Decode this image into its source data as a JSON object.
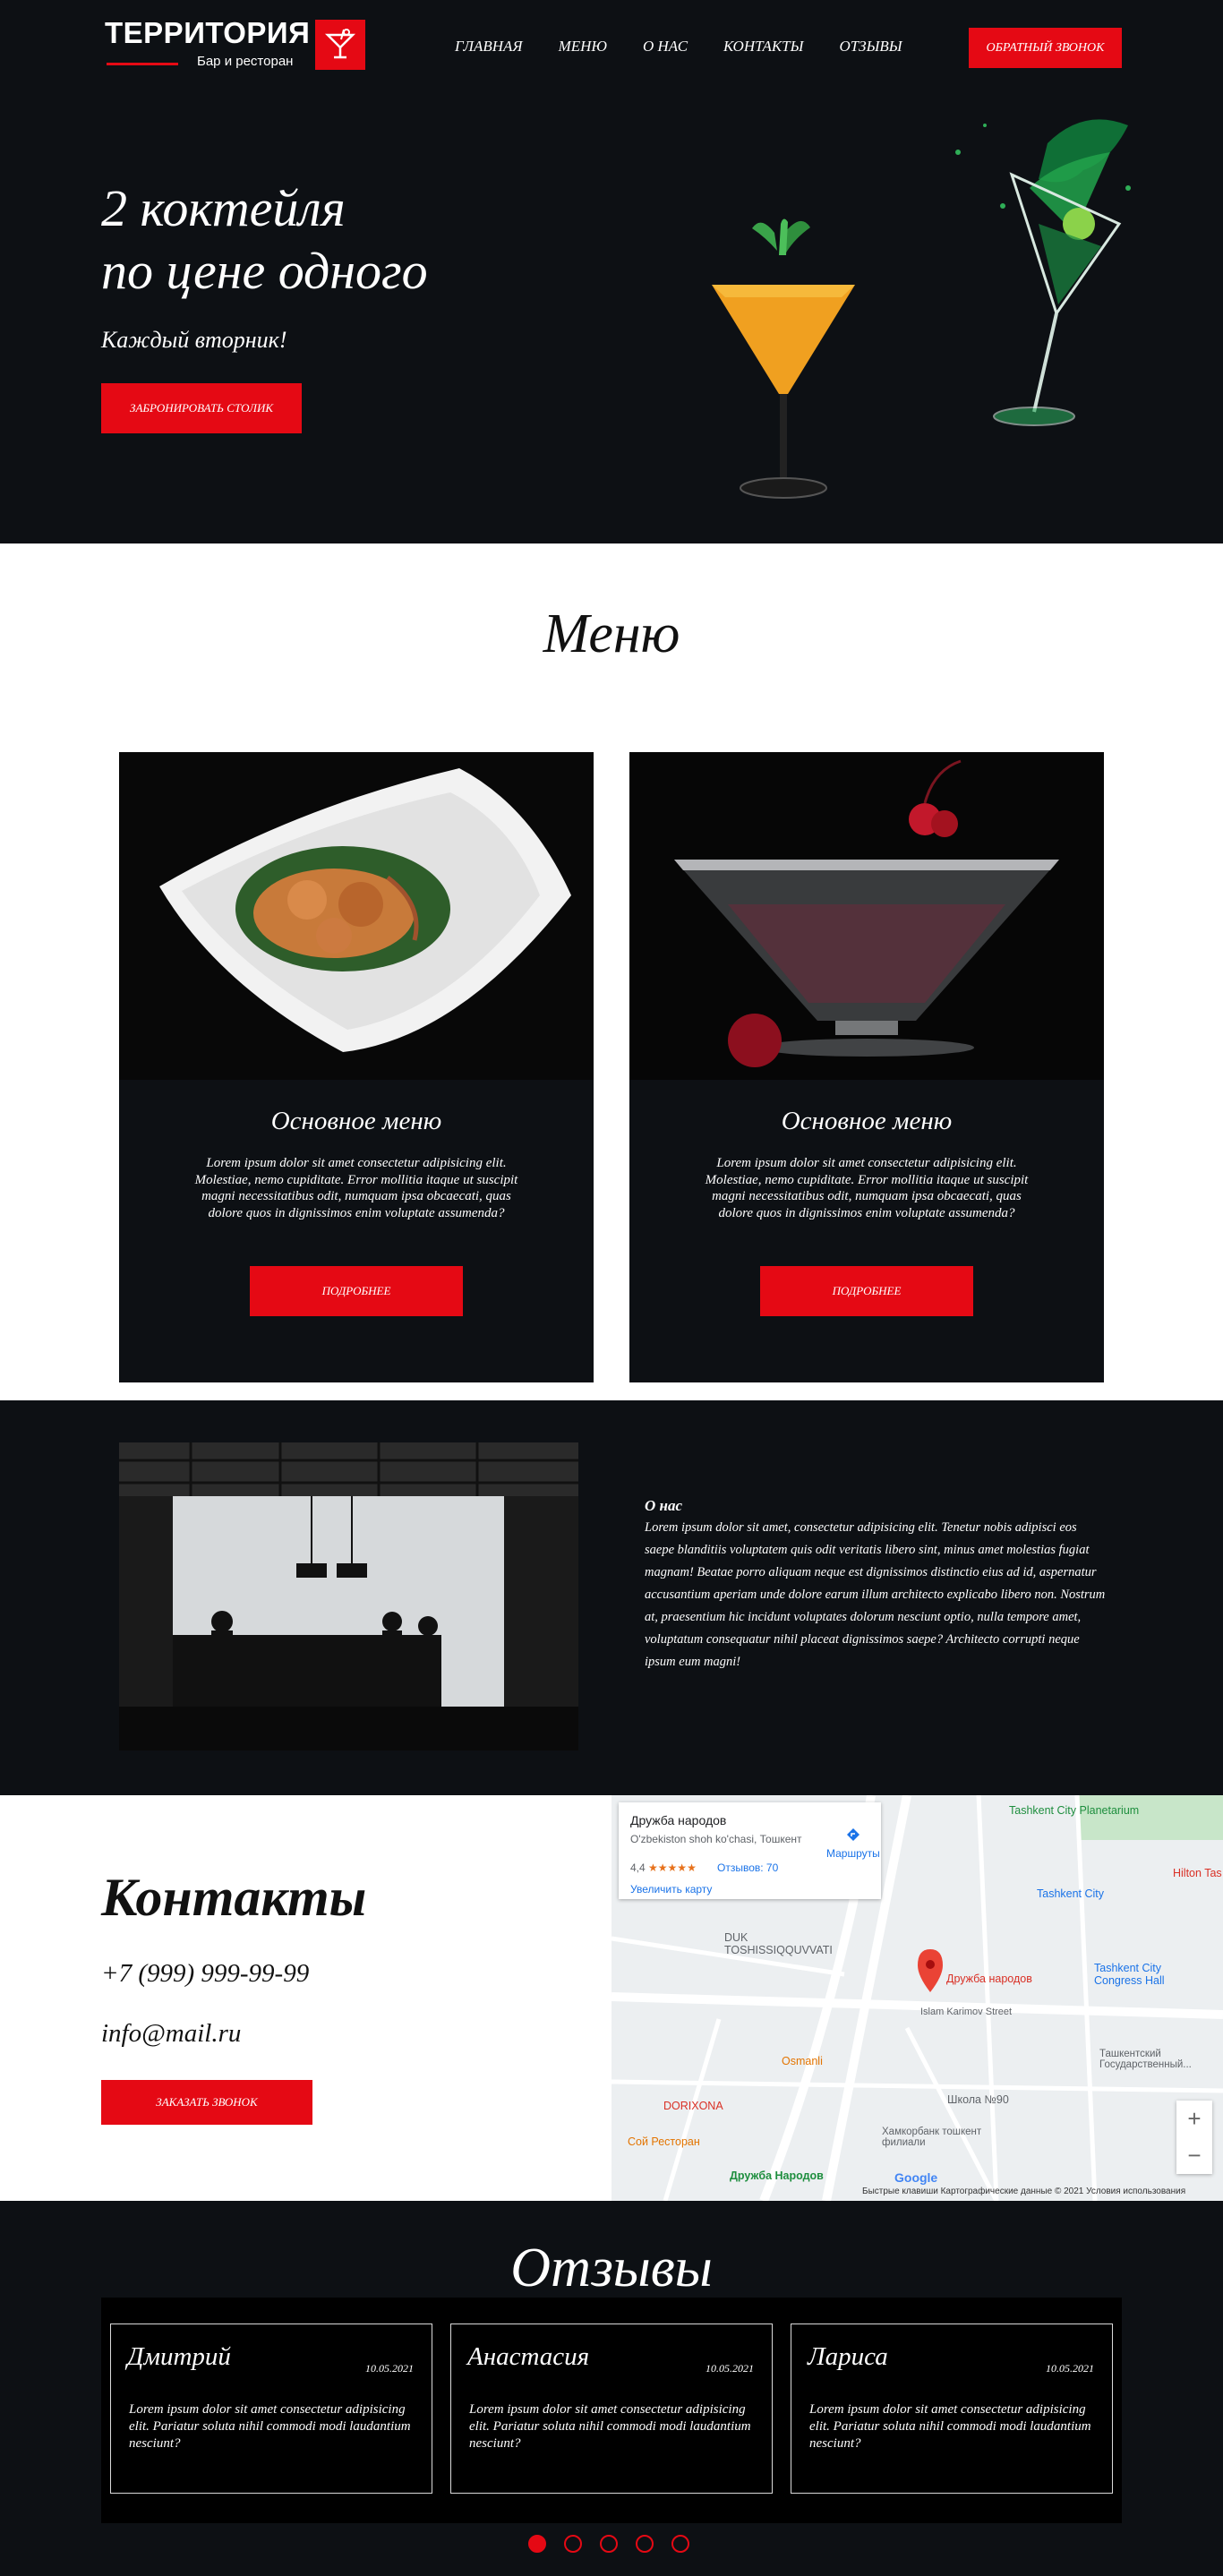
{
  "header": {
    "logo_title": "ТЕРРИТОРИЯ",
    "logo_subtitle": "Бар и ресторан",
    "nav": [
      {
        "label": "ГЛАВНАЯ"
      },
      {
        "label": "МЕНЮ"
      },
      {
        "label": "О НАС"
      },
      {
        "label": "КОНТАКТЫ"
      },
      {
        "label": "ОТЗЫВЫ"
      }
    ],
    "callback_button": "ОБРАТНЫЙ ЗВОНОК"
  },
  "hero": {
    "title_line1": "2 коктейля",
    "title_line2": "по цене одного",
    "subtitle": "Каждый вторник!",
    "button": "ЗАБРОНИРОВАТЬ СТОЛИК"
  },
  "menu": {
    "title": "Меню",
    "cards": [
      {
        "name": "Основное меню",
        "text": "Lorem ipsum dolor sit amet consectetur adipisicing elit. Molestiae, nemo cupiditate. Error mollitia itaque ut suscipit magni necessitatibus odit, numquam ipsa obcaecati, quas dolore quos in dignissimos enim voluptate assumenda?",
        "button": "ПОДРОБНЕЕ"
      },
      {
        "name": "Основное меню",
        "text": "Lorem ipsum dolor sit amet consectetur adipisicing elit. Molestiae, nemo cupiditate. Error mollitia itaque ut suscipit magni necessitatibus odit, numquam ipsa obcaecati, quas dolore quos in dignissimos enim voluptate assumenda?",
        "button": "ПОДРОБНЕЕ"
      }
    ]
  },
  "about": {
    "heading": "О нас",
    "text": "Lorem ipsum dolor sit amet, consectetur adipisicing elit. Tenetur nobis adipisci eos saepe blanditiis voluptatem quis odit veritatis libero sint, minus amet molestias fugiat magnam! Beatae porro aliquam neque est dignissimos distinctio eius ad id, aspernatur accusantium aperiam unde dolore earum illum architecto explicabo libero non. Nostrum at, praesentium hic incidunt voluptates dolorum nesciunt optio, nulla tempore amet, voluptatum consequatur nihil placeat dignissimos saepe? Architecto corrupti neque ipsum eum magni!"
  },
  "contacts": {
    "title": "Контакты",
    "phone": "+7 (999) 999-99-99",
    "email": "info@mail.ru",
    "button": "ЗАКАЗАТЬ ЗВОНОК"
  },
  "map": {
    "place_title": "Дружба народов",
    "place_address": "O'zbekiston shoh ko'chasi, Тошкент",
    "rating": "4,4",
    "stars": "★★★★★",
    "reviews": "Отзывов: 70",
    "routes": "Маршруты",
    "enlarge": "Увеличить карту",
    "labels": [
      {
        "text": "Tashkent City Planetarium",
        "color": "#1e8e3e"
      },
      {
        "text": "Hilton Tas",
        "color": "#d93025"
      },
      {
        "text": "Tashkent City",
        "color": "#1a73e8"
      },
      {
        "text": "DUK TOSHISSIQQUVVATI",
        "color": "#5f6368"
      },
      {
        "text": "Дружба народов",
        "color": "#d93025"
      },
      {
        "text": "Tashkent City Congress Hall",
        "color": "#1a73e8"
      },
      {
        "text": "Islam Karimov Street",
        "color": "#5f6368"
      },
      {
        "text": "Ташкентский Государственный...",
        "color": "#5f6368"
      },
      {
        "text": "Osmanli",
        "color": "#e37400"
      },
      {
        "text": "DORIXONA",
        "color": "#d93025"
      },
      {
        "text": "Школа №90",
        "color": "#5f6368"
      },
      {
        "text": "Сой Ресторан",
        "color": "#e37400"
      },
      {
        "text": "Хамкорбанк тошкент филиали",
        "color": "#5f6368"
      },
      {
        "text": "Дружба Народов",
        "color": "#1e8e3e"
      }
    ],
    "footer": "Быстрые клавиши   Картографические данные © 2021   Условия использования",
    "google": "Google",
    "zoom_in": "+",
    "zoom_out": "−"
  },
  "reviews": {
    "title": "Отзывы",
    "items": [
      {
        "name": "Дмитрий",
        "date": "10.05.2021",
        "text": "Lorem ipsum dolor sit amet consectetur adipisicing elit. Pariatur soluta nihil commodi modi laudantium nesciunt?"
      },
      {
        "name": "Анастасия",
        "date": "10.05.2021",
        "text": "Lorem ipsum dolor sit amet consectetur adipisicing elit. Pariatur soluta nihil commodi modi laudantium nesciunt?"
      },
      {
        "name": "Лариса",
        "date": "10.05.2021",
        "text": "Lorem ipsum dolor sit amet consectetur adipisicing elit. Pariatur soluta nihil commodi modi laudantium nesciunt?"
      }
    ],
    "active_dot": 1,
    "dots_count": 5
  },
  "colors": {
    "accent": "#e50914",
    "dark_bg": "#0d1014",
    "light_bg": "#ffffff"
  }
}
